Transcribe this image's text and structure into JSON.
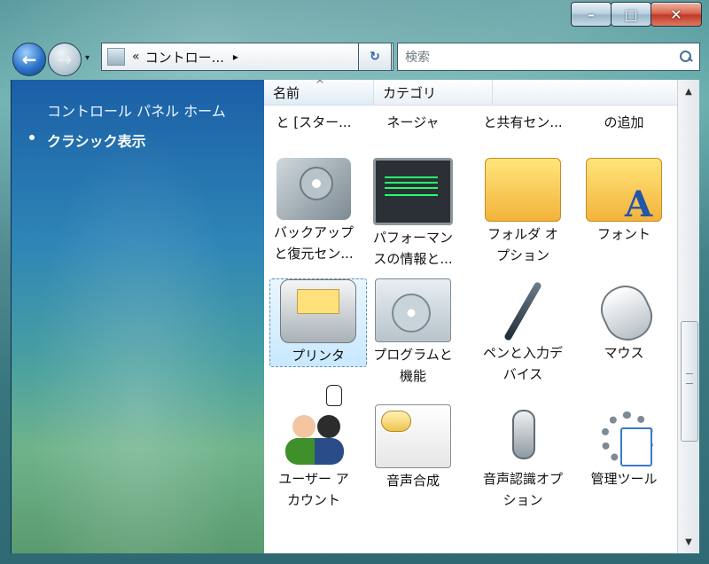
{
  "window": {
    "caption_buttons": {
      "minimize": "–",
      "maximize": "□",
      "close": "✕"
    }
  },
  "nav": {
    "address_chevrons": "«",
    "address_text": "コントロー...",
    "address_arrow": "▸",
    "address_drop": "▾",
    "refresh_label": "↻",
    "search_placeholder": "検索"
  },
  "left_pane": {
    "home_link": "コントロール パネル ホーム",
    "current_view": "クラシック表示"
  },
  "content": {
    "columns": {
      "name": "名前",
      "category": "カテゴリ"
    },
    "sort_caret": "^",
    "partial_row": [
      {
        "line1": "と [スター..."
      },
      {
        "line1": "ネージャ"
      },
      {
        "line1": "と共有セン..."
      },
      {
        "line1": "の追加"
      }
    ],
    "tiles": [
      {
        "id": "backup",
        "icon": "backup-restore-icon",
        "line1": "バックアップ",
        "line2": "と復元セン..."
      },
      {
        "id": "performance",
        "icon": "performance-monitor-icon",
        "line1": "パフォーマン",
        "line2": "スの情報と..."
      },
      {
        "id": "folder_options",
        "icon": "folder-options-icon",
        "line1": "フォルダ オ",
        "line2": "プション"
      },
      {
        "id": "fonts",
        "icon": "fonts-folder-icon",
        "line1": "フォント",
        "line2": ""
      },
      {
        "id": "printer",
        "icon": "printer-icon",
        "line1": "プリンタ",
        "line2": ""
      },
      {
        "id": "programs",
        "icon": "programs-features-icon",
        "line1": "プログラムと",
        "line2": "機能"
      },
      {
        "id": "pen_input",
        "icon": "pen-input-icon",
        "line1": "ペンと入力デ",
        "line2": "バイス"
      },
      {
        "id": "mouse",
        "icon": "mouse-icon",
        "line1": "マウス",
        "line2": ""
      },
      {
        "id": "user_accounts",
        "icon": "user-accounts-icon",
        "line1": "ユーザー ア",
        "line2": "カウント"
      },
      {
        "id": "tts",
        "icon": "text-to-speech-icon",
        "line1": "音声合成",
        "line2": ""
      },
      {
        "id": "speech_recognition",
        "icon": "speech-recognition-icon",
        "line1": "音声認識オプ",
        "line2": "ション"
      },
      {
        "id": "admin_tools",
        "icon": "admin-tools-icon",
        "line1": "管理ツール",
        "line2": ""
      }
    ]
  },
  "scrollbar": {
    "up": "▲",
    "down": "▼",
    "grip": "≡"
  }
}
